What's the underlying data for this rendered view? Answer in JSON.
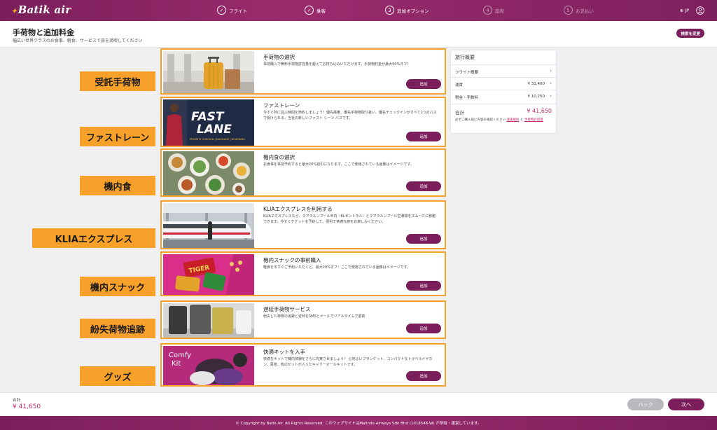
{
  "header": {
    "logo": "Batik air",
    "steps": [
      {
        "label": "フライト",
        "mark": "✓"
      },
      {
        "label": "乗客",
        "mark": "✓"
      },
      {
        "label": "追加オプション",
        "mark": "3"
      },
      {
        "label": "座席",
        "mark": "4"
      },
      {
        "label": "お支払い",
        "mark": "5"
      }
    ],
    "lang": "JP"
  },
  "subheader": {
    "title": "手荷物と追加料金",
    "subtitle": "幅広い世界クラスのお食事、軽食、サービスで旅を満喫してください",
    "change_button": "検索を変更"
  },
  "labels": [
    "受託手荷物",
    "ファストレーン",
    "機内食",
    "KLIAエクスプレス",
    "機内スナック",
    "紛失荷物追跡",
    "グッズ"
  ],
  "cards": [
    {
      "title": "手荷物の選択",
      "desc": "事前購入で無料手荷物許容量を超えてお持ち込みいただけます。手荷物料金が最大50%オフ！",
      "add": "追加"
    },
    {
      "title": "ファストレーン",
      "desc": "今すぐ列に並ぶ時間を節約しましょう！優先搭乗、優先手荷物取り扱い、優先チェックインがすべて1つのパスで受けられる、当社の新しいファスト レーン パスです。",
      "add": "追加",
      "img_text1": "FAST",
      "img_text2": "LANE",
      "img_text3": "PRIORITY CHECK-IN | BAGGAGE | BOARDING"
    },
    {
      "title": "機内食の選択",
      "desc": "お食事を事前予約すると最大20%割引になります。ここで使用されている画像はイメージです。",
      "add": "追加"
    },
    {
      "title": "KLIAエクスプレスを利用する",
      "desc": "KLIAエクスプレスなら、クアラルンプール市内（KLセントラル）とクアラルンプール空港間をスムーズに移動できます。今すぐチケットを予約して、便利で快適な旅をお楽しみください。",
      "add": "追加"
    },
    {
      "title": "機内スナックの事前購入",
      "desc": "軽食を今すぐご予約いただくと、最大20%オフ！ここで使用されている画像はイメージです。",
      "add": "追加",
      "img_text1": "TIGER"
    },
    {
      "title": "遅延手荷物サービス",
      "desc": "紛失した荷物の追跡と返却をSMSとメールでリアルタイムで更新",
      "add": "追加"
    },
    {
      "title": "快適キットを入手",
      "desc": "快適なキットで機内体験をさらに充実させましょう！ 心地よいブランケット、コンパクトなトラベルイヤホン、耳栓、枕のセットが入ったキャリーオールキットです。",
      "add": "追加",
      "img_text1": "Comfy",
      "img_text2": "Kit"
    }
  ],
  "summary": {
    "title": "旅行概要",
    "rows": [
      {
        "label": "フライト概要",
        "value": ""
      },
      {
        "label": "運賃",
        "value": "¥ 31,400"
      },
      {
        "label": "税金・手数料",
        "value": "¥ 10,250"
      }
    ],
    "total_label": "合計",
    "total_value": "¥ 41,650",
    "note_prefix": "必ずご購入前に内容を確認ください",
    "note_link1": "運賃規則",
    "note_mid": "と",
    "note_link2": "手荷物許容量"
  },
  "totalbar": {
    "label": "合計",
    "value": "¥ 41,650",
    "back": "バック",
    "next": "次へ"
  },
  "footer": "© Copyright by Batik Air. All Rights Reserved. このウェブサイトはMalindo Airways Sdn Bhd (1018546-W) が所有・運営しています。",
  "colors": {
    "brand": "#7a1f5c",
    "highlight": "#f7a12b",
    "price": "#c0306e"
  }
}
